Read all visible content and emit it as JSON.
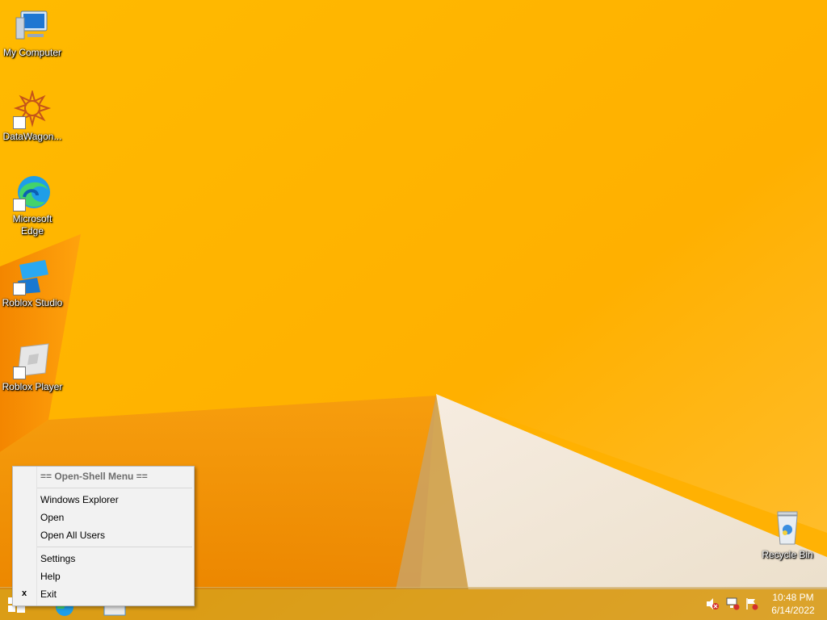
{
  "desktop": {
    "icons": [
      {
        "label": "My Computer",
        "icon": "my-computer-icon"
      },
      {
        "label": "DataWagon...",
        "icon": "datawagon-icon"
      },
      {
        "label_line1": "Microsoft",
        "label_line2": "Edge",
        "icon": "edge-icon"
      },
      {
        "label": "Roblox Studio",
        "icon": "roblox-studio-icon"
      },
      {
        "label": "Roblox Player",
        "icon": "roblox-player-icon"
      },
      {
        "label": "Recycle Bin",
        "icon": "recycle-bin-icon"
      }
    ]
  },
  "context_menu": {
    "header": "== Open-Shell Menu ==",
    "items": [
      "Windows Explorer",
      "Open",
      "Open All Users"
    ],
    "items2": [
      "Settings",
      "Help",
      "Exit"
    ],
    "exit_glyph": "x"
  },
  "taskbar": {
    "clock_time": "10:48 PM",
    "clock_date": "6/14/2022",
    "tray_icons": [
      "volume-muted-icon",
      "network-disconnected-icon",
      "action-center-flag-icon"
    ]
  },
  "colors": {
    "wallpaper_main": "#ffb400",
    "wallpaper_shadow": "#f08a00",
    "wallpaper_light": "#f3e6d0"
  }
}
